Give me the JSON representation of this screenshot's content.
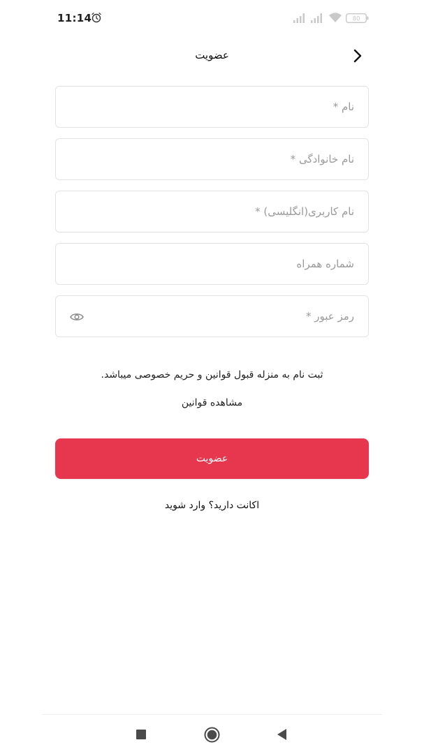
{
  "status_bar": {
    "time": "11:14",
    "battery": "80",
    "icons": [
      "alarm-icon",
      "signal-icon",
      "signal-icon",
      "wifi-icon",
      "battery-icon"
    ]
  },
  "header": {
    "title": "عضویت",
    "back_icon": "chevron-right-icon"
  },
  "form": {
    "first_name": {
      "placeholder": "نام *",
      "value": ""
    },
    "last_name": {
      "placeholder": "نام خانوادگی *",
      "value": ""
    },
    "username": {
      "placeholder": "نام کاربری(انگلیسی) *",
      "value": ""
    },
    "phone": {
      "placeholder": "شماره همراه",
      "value": ""
    },
    "password": {
      "placeholder": "رمز عبور *",
      "value": "",
      "toggle_icon": "eye-icon"
    }
  },
  "terms": {
    "notice": "ثبت نام به منزله قبول قوانین و حریم خصوصی میباشد.",
    "link": "مشاهده قوانین"
  },
  "submit_label": "عضویت",
  "login_prompt": "اکانت دارید؟ وارد شوید",
  "nav": {
    "icons": [
      "recent-apps-icon",
      "home-icon",
      "back-icon"
    ]
  },
  "colors": {
    "accent": "#e6374f",
    "field_border": "#e3e3e3",
    "placeholder": "#9a9a9a",
    "text": "#222222"
  }
}
